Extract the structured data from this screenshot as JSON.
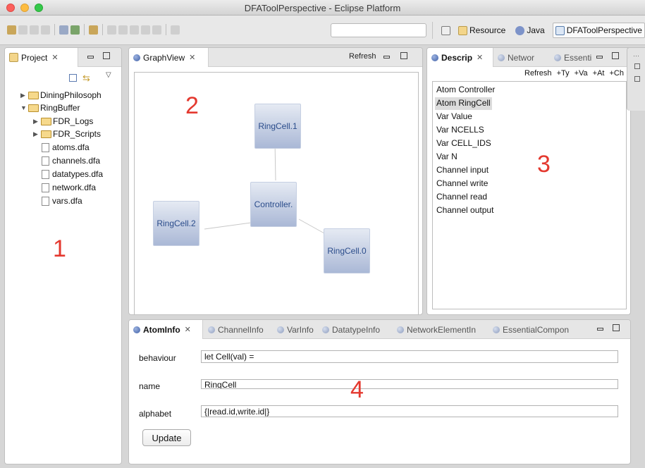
{
  "window": {
    "title": "DFAToolPerspective - Eclipse Platform"
  },
  "toolbar": {
    "quick_access_value": ""
  },
  "perspectives": [
    {
      "label": "Resource",
      "icon": "resource-perspective-icon"
    },
    {
      "label": "Java",
      "icon": "java-perspective-icon"
    },
    {
      "label": "DFAToolPerspective",
      "icon": "dfa-perspective-icon",
      "active": true
    }
  ],
  "project": {
    "tab_label": "Project",
    "tree": [
      {
        "label": "DiningPhilosoph",
        "type": "folder",
        "expanded": false,
        "level": 0
      },
      {
        "label": "RingBuffer",
        "type": "folder",
        "expanded": true,
        "level": 0
      },
      {
        "label": "FDR_Logs",
        "type": "folder",
        "expanded": false,
        "level": 1
      },
      {
        "label": "FDR_Scripts",
        "type": "folder",
        "expanded": false,
        "level": 1
      },
      {
        "label": "atoms.dfa",
        "type": "file",
        "level": 1
      },
      {
        "label": "channels.dfa",
        "type": "file",
        "level": 1
      },
      {
        "label": "datatypes.dfa",
        "type": "file",
        "level": 1
      },
      {
        "label": "network.dfa",
        "type": "file",
        "level": 1
      },
      {
        "label": "vars.dfa",
        "type": "file",
        "level": 1
      }
    ]
  },
  "graph": {
    "tab_label": "GraphView",
    "refresh_label": "Refresh",
    "nodes": [
      {
        "label": "RingCell.1"
      },
      {
        "label": "Controller."
      },
      {
        "label": "RingCell.2"
      },
      {
        "label": "RingCell.0"
      }
    ]
  },
  "description": {
    "tabs": [
      "Descrip",
      "Networ",
      "Essenti"
    ],
    "actions": [
      "Refresh",
      "+Ty",
      "+Va",
      "+At",
      "+Ch"
    ],
    "items": [
      "Atom Controller",
      "Atom RingCell",
      "Var Value",
      "Var NCELLS",
      "Var CELL_IDS",
      "Var N",
      "Channel input",
      "Channel write",
      "Channel read",
      "Channel output"
    ],
    "selected_index": 1
  },
  "atominfo": {
    "tabs": [
      "AtomInfo",
      "ChannelInfo",
      "VarInfo",
      "DatatypeInfo",
      "NetworkElementIn",
      "EssentialCompon"
    ],
    "fields": [
      {
        "label": "behaviour",
        "value": "let Cell(val) ="
      },
      {
        "label": "name",
        "value": "RingCell"
      },
      {
        "label": "alphabet",
        "value": "{|read.id,write.id|}"
      }
    ],
    "update_label": "Update"
  },
  "annotations": [
    "1",
    "2",
    "3",
    "4"
  ]
}
